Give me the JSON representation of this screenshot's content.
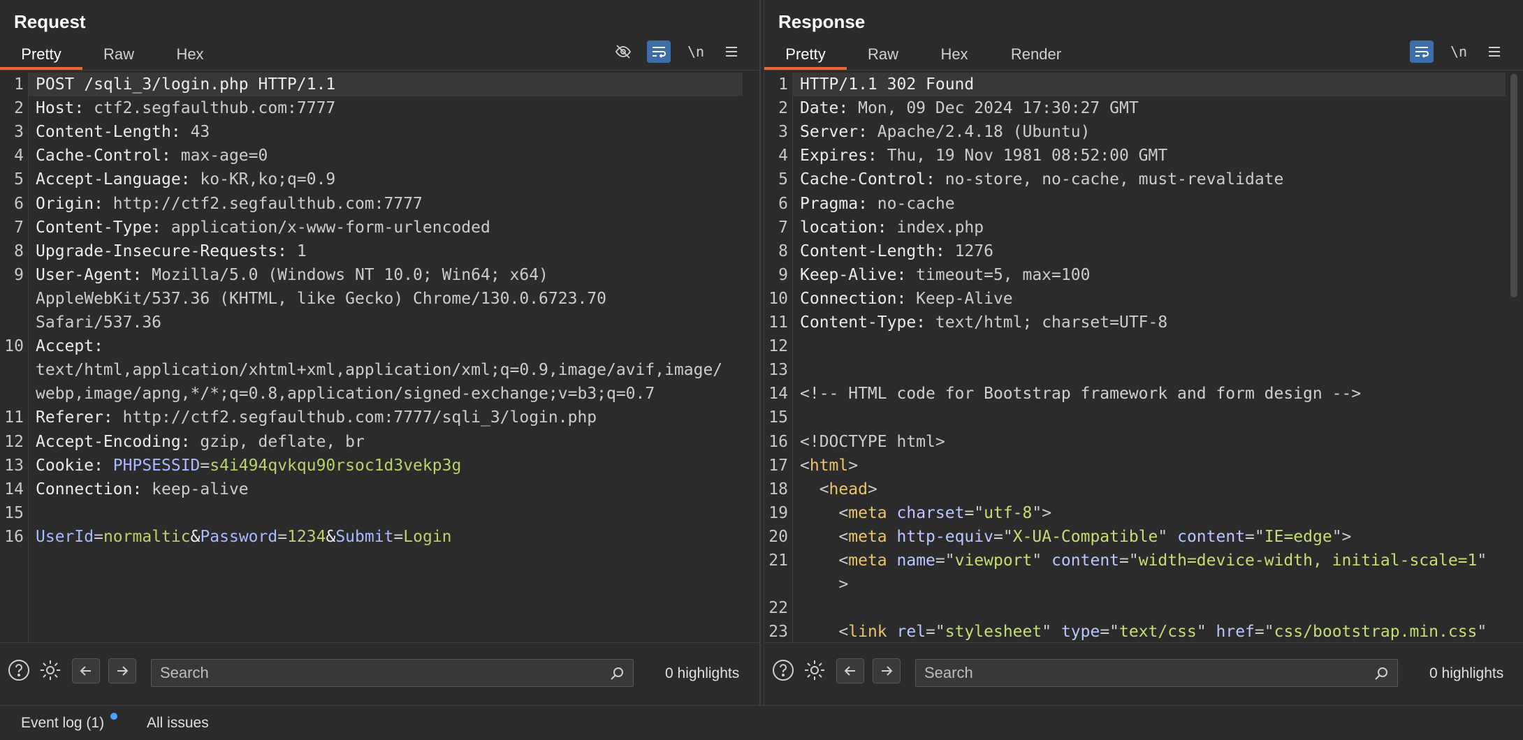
{
  "request": {
    "title": "Request",
    "tabs": [
      "Pretty",
      "Raw",
      "Hex"
    ],
    "active_tab": "Pretty",
    "toolbar": {
      "newline": "\\n"
    },
    "lines": [
      {
        "n": "1",
        "segs": [
          [
            "hk",
            "POST /sqli_3/login.php HTTP/1.1"
          ]
        ]
      },
      {
        "n": "2",
        "segs": [
          [
            "hk",
            "Host: "
          ],
          [
            "hv",
            "ctf2.segfaulthub.com:7777"
          ]
        ]
      },
      {
        "n": "3",
        "segs": [
          [
            "hk",
            "Content-Length: "
          ],
          [
            "hv",
            "43"
          ]
        ]
      },
      {
        "n": "4",
        "segs": [
          [
            "hk",
            "Cache-Control: "
          ],
          [
            "hv",
            "max-age=0"
          ]
        ]
      },
      {
        "n": "5",
        "segs": [
          [
            "hk",
            "Accept-Language: "
          ],
          [
            "hv",
            "ko-KR,ko;q=0.9"
          ]
        ]
      },
      {
        "n": "6",
        "segs": [
          [
            "hk",
            "Origin: "
          ],
          [
            "hv",
            "http://ctf2.segfaulthub.com:7777"
          ]
        ]
      },
      {
        "n": "7",
        "segs": [
          [
            "hk",
            "Content-Type: "
          ],
          [
            "hv",
            "application/x-www-form-urlencoded"
          ]
        ]
      },
      {
        "n": "8",
        "segs": [
          [
            "hk",
            "Upgrade-Insecure-Requests: "
          ],
          [
            "hv",
            "1"
          ]
        ]
      },
      {
        "n": "9",
        "segs": [
          [
            "hk",
            "User-Agent: "
          ],
          [
            "hv",
            "Mozilla/5.0 (Windows NT 10.0; Win64; x64)"
          ]
        ]
      },
      {
        "n": "",
        "segs": [
          [
            "hv",
            "AppleWebKit/537.36 (KHTML, like Gecko) Chrome/130.0.6723.70"
          ]
        ]
      },
      {
        "n": "",
        "segs": [
          [
            "hv",
            "Safari/537.36"
          ]
        ]
      },
      {
        "n": "10",
        "segs": [
          [
            "hk",
            "Accept: "
          ]
        ]
      },
      {
        "n": "",
        "segs": [
          [
            "hv",
            "text/html,application/xhtml+xml,application/xml;q=0.9,image/avif,image/"
          ]
        ]
      },
      {
        "n": "",
        "segs": [
          [
            "hv",
            "webp,image/apng,*/*;q=0.8,application/signed-exchange;v=b3;q=0.7"
          ]
        ]
      },
      {
        "n": "11",
        "segs": [
          [
            "hk",
            "Referer: "
          ],
          [
            "hv",
            "http://ctf2.segfaulthub.com:7777/sqli_3/login.php"
          ]
        ]
      },
      {
        "n": "12",
        "segs": [
          [
            "hk",
            "Accept-Encoding: "
          ],
          [
            "hv",
            "gzip, deflate, br"
          ]
        ]
      },
      {
        "n": "13",
        "segs": [
          [
            "hk",
            "Cookie: "
          ],
          [
            "pk",
            "PHPSESSID"
          ],
          [
            "hv",
            "="
          ],
          [
            "pv",
            "s4i494qvkqu90rsoc1d3vekp3g"
          ]
        ]
      },
      {
        "n": "14",
        "segs": [
          [
            "hk",
            "Connection: "
          ],
          [
            "hv",
            "keep-alive"
          ]
        ]
      },
      {
        "n": "15",
        "segs": []
      },
      {
        "n": "16",
        "segs": [
          [
            "pk",
            "UserId"
          ],
          [
            "hv",
            "="
          ],
          [
            "pv",
            "normaltic"
          ],
          [
            "hk",
            "&"
          ],
          [
            "pk",
            "Password"
          ],
          [
            "hv",
            "="
          ],
          [
            "pv",
            "1234"
          ],
          [
            "hk",
            "&"
          ],
          [
            "pk",
            "Submit"
          ],
          [
            "hv",
            "="
          ],
          [
            "pv",
            "Login"
          ]
        ]
      }
    ],
    "search": {
      "placeholder": "Search",
      "highlights": "0 highlights"
    }
  },
  "response": {
    "title": "Response",
    "tabs": [
      "Pretty",
      "Raw",
      "Hex",
      "Render"
    ],
    "active_tab": "Pretty",
    "toolbar": {
      "newline": "\\n"
    },
    "lines": [
      {
        "n": "1",
        "segs": [
          [
            "hk",
            "HTTP/1.1 302 Found"
          ]
        ]
      },
      {
        "n": "2",
        "segs": [
          [
            "hk",
            "Date: "
          ],
          [
            "hv",
            "Mon, 09 Dec 2024 17:30:27 GMT"
          ]
        ]
      },
      {
        "n": "3",
        "segs": [
          [
            "hk",
            "Server: "
          ],
          [
            "hv",
            "Apache/2.4.18 (Ubuntu)"
          ]
        ]
      },
      {
        "n": "4",
        "segs": [
          [
            "hk",
            "Expires: "
          ],
          [
            "hv",
            "Thu, 19 Nov 1981 08:52:00 GMT"
          ]
        ]
      },
      {
        "n": "5",
        "segs": [
          [
            "hk",
            "Cache-Control: "
          ],
          [
            "hv",
            "no-store, no-cache, must-revalidate"
          ]
        ]
      },
      {
        "n": "6",
        "segs": [
          [
            "hk",
            "Pragma: "
          ],
          [
            "hv",
            "no-cache"
          ]
        ]
      },
      {
        "n": "7",
        "segs": [
          [
            "hk",
            "location: "
          ],
          [
            "hv",
            "index.php"
          ]
        ]
      },
      {
        "n": "8",
        "segs": [
          [
            "hk",
            "Content-Length: "
          ],
          [
            "hv",
            "1276"
          ]
        ]
      },
      {
        "n": "9",
        "segs": [
          [
            "hk",
            "Keep-Alive: "
          ],
          [
            "hv",
            "timeout=5, max=100"
          ]
        ]
      },
      {
        "n": "10",
        "segs": [
          [
            "hk",
            "Connection: "
          ],
          [
            "hv",
            "Keep-Alive"
          ]
        ]
      },
      {
        "n": "11",
        "segs": [
          [
            "hk",
            "Content-Type: "
          ],
          [
            "hv",
            "text/html; charset=UTF-8"
          ]
        ]
      },
      {
        "n": "12",
        "segs": []
      },
      {
        "n": "13",
        "segs": []
      },
      {
        "n": "14",
        "segs": [
          [
            "cm",
            "<!-- HTML code for Bootstrap framework and form design -->"
          ]
        ]
      },
      {
        "n": "15",
        "segs": []
      },
      {
        "n": "16",
        "segs": [
          [
            "hv",
            "<!DOCTYPE html>"
          ]
        ]
      },
      {
        "n": "17",
        "segs": [
          [
            "hv",
            "<"
          ],
          [
            "tg",
            "html"
          ],
          [
            "hv",
            ">"
          ]
        ]
      },
      {
        "n": "18",
        "segs": [
          [
            "hv",
            "  <"
          ],
          [
            "tg",
            "head"
          ],
          [
            "hv",
            ">"
          ]
        ]
      },
      {
        "n": "19",
        "segs": [
          [
            "hv",
            "    <"
          ],
          [
            "tg",
            "meta"
          ],
          [
            "hv",
            " "
          ],
          [
            "at",
            "charset"
          ],
          [
            "hv",
            "=\""
          ],
          [
            "av",
            "utf-8"
          ],
          [
            "hv",
            "\">"
          ]
        ]
      },
      {
        "n": "20",
        "segs": [
          [
            "hv",
            "    <"
          ],
          [
            "tg",
            "meta"
          ],
          [
            "hv",
            " "
          ],
          [
            "at",
            "http-equiv"
          ],
          [
            "hv",
            "=\""
          ],
          [
            "av",
            "X-UA-Compatible"
          ],
          [
            "hv",
            "\" "
          ],
          [
            "at",
            "content"
          ],
          [
            "hv",
            "=\""
          ],
          [
            "av",
            "IE=edge"
          ],
          [
            "hv",
            "\">"
          ]
        ]
      },
      {
        "n": "21",
        "segs": [
          [
            "hv",
            "    <"
          ],
          [
            "tg",
            "meta"
          ],
          [
            "hv",
            " "
          ],
          [
            "at",
            "name"
          ],
          [
            "hv",
            "=\""
          ],
          [
            "av",
            "viewport"
          ],
          [
            "hv",
            "\" "
          ],
          [
            "at",
            "content"
          ],
          [
            "hv",
            "=\""
          ],
          [
            "av",
            "width=device-width, initial-scale=1"
          ],
          [
            "hv",
            "\""
          ]
        ]
      },
      {
        "n": "",
        "segs": [
          [
            "hv",
            "    >"
          ]
        ]
      },
      {
        "n": "22",
        "segs": []
      },
      {
        "n": "23",
        "segs": [
          [
            "hv",
            "    <"
          ],
          [
            "tg",
            "link"
          ],
          [
            "hv",
            " "
          ],
          [
            "at",
            "rel"
          ],
          [
            "hv",
            "=\""
          ],
          [
            "av",
            "stylesheet"
          ],
          [
            "hv",
            "\" "
          ],
          [
            "at",
            "type"
          ],
          [
            "hv",
            "=\""
          ],
          [
            "av",
            "text/css"
          ],
          [
            "hv",
            "\" "
          ],
          [
            "at",
            "href"
          ],
          [
            "hv",
            "=\""
          ],
          [
            "av",
            "css/bootstrap.min.css"
          ],
          [
            "hv",
            "\""
          ]
        ]
      }
    ],
    "search": {
      "placeholder": "Search",
      "highlights": "0 highlights"
    }
  },
  "status_bar": {
    "event_log": "Event log (1)",
    "all_issues": "All issues"
  },
  "colors": {
    "accent_tab": "#e8693a",
    "toggle_on": "#3d6ea8",
    "notification_dot": "#4aa3ff"
  }
}
